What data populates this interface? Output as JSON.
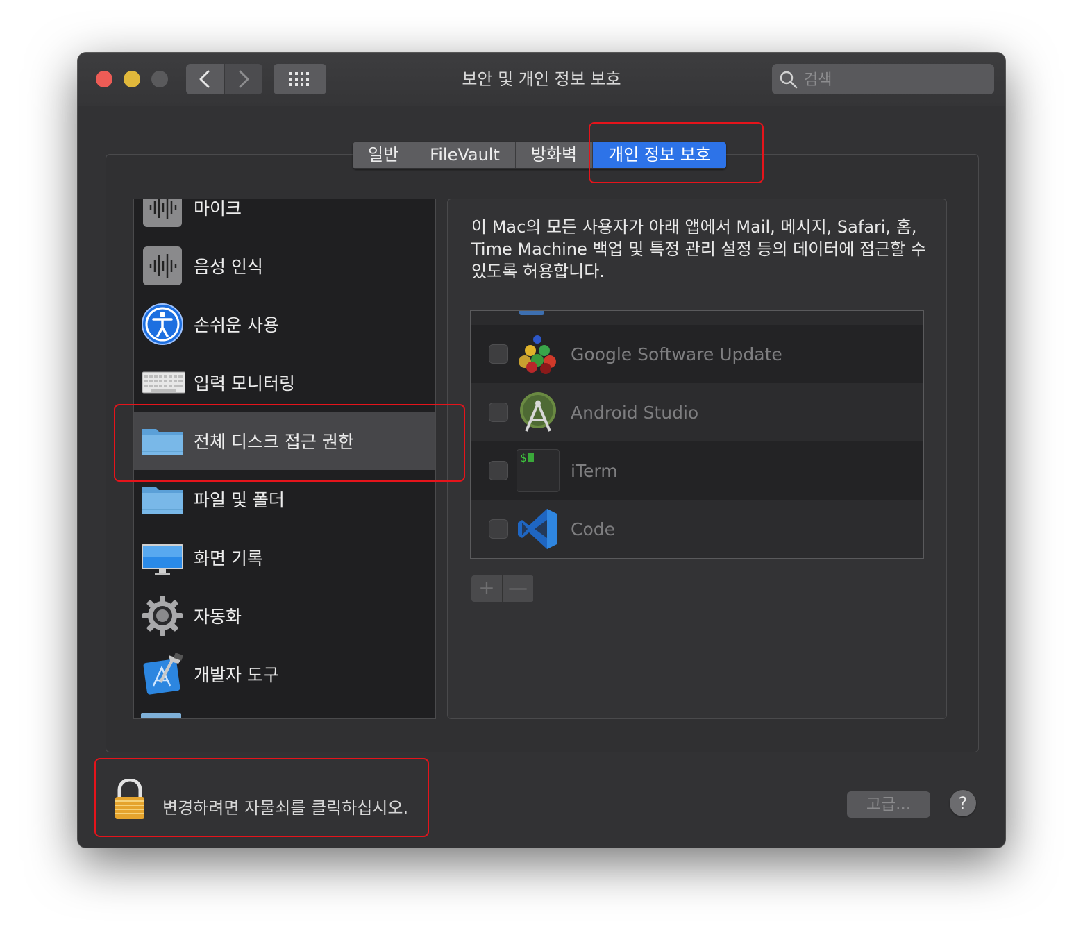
{
  "window": {
    "title": "보안 및 개인 정보 보호"
  },
  "search": {
    "placeholder": "검색"
  },
  "tabs": [
    {
      "label": "일반",
      "active": false
    },
    {
      "label": "FileVault",
      "active": false
    },
    {
      "label": "방화벽",
      "active": false
    },
    {
      "label": "개인 정보 보호",
      "active": true
    }
  ],
  "sidebar": {
    "items": [
      {
        "label": "마이크",
        "icon": "microphone-icon"
      },
      {
        "label": "음성 인식",
        "icon": "speech-recognition-icon"
      },
      {
        "label": "손쉬운 사용",
        "icon": "accessibility-icon"
      },
      {
        "label": "입력 모니터링",
        "icon": "keyboard-icon"
      },
      {
        "label": "전체 디스크 접근 권한",
        "icon": "folder-icon",
        "selected": true
      },
      {
        "label": "파일 및 폴더",
        "icon": "folder-icon"
      },
      {
        "label": "화면 기록",
        "icon": "display-icon"
      },
      {
        "label": "자동화",
        "icon": "gear-icon"
      },
      {
        "label": "개발자 도구",
        "icon": "xcode-icon"
      }
    ]
  },
  "main": {
    "description": "이 Mac의 모든 사용자가 아래 앱에서 Mail, 메시지, Safari, 홈, Time Machine 백업 및 특정 관리 설정 등의 데이터에 접근할 수 있도록 허용합니다.",
    "apps": [
      {
        "name": "Google Software Update",
        "checked": false,
        "icon": "google-software-update-icon"
      },
      {
        "name": "Android Studio",
        "checked": false,
        "icon": "android-studio-icon"
      },
      {
        "name": "iTerm",
        "checked": false,
        "icon": "iterm-icon",
        "icon_text": "$"
      },
      {
        "name": "Code",
        "checked": false,
        "icon": "vscode-icon"
      }
    ],
    "add_label": "+",
    "remove_label": "—"
  },
  "footer": {
    "lock_text": "변경하려면 자물쇠를 클릭하십시오.",
    "advanced_label": "고급...",
    "help_label": "?"
  },
  "colors": {
    "accent": "#2d73e8",
    "annotation": "#e5141b",
    "window_bg": "#323234"
  }
}
